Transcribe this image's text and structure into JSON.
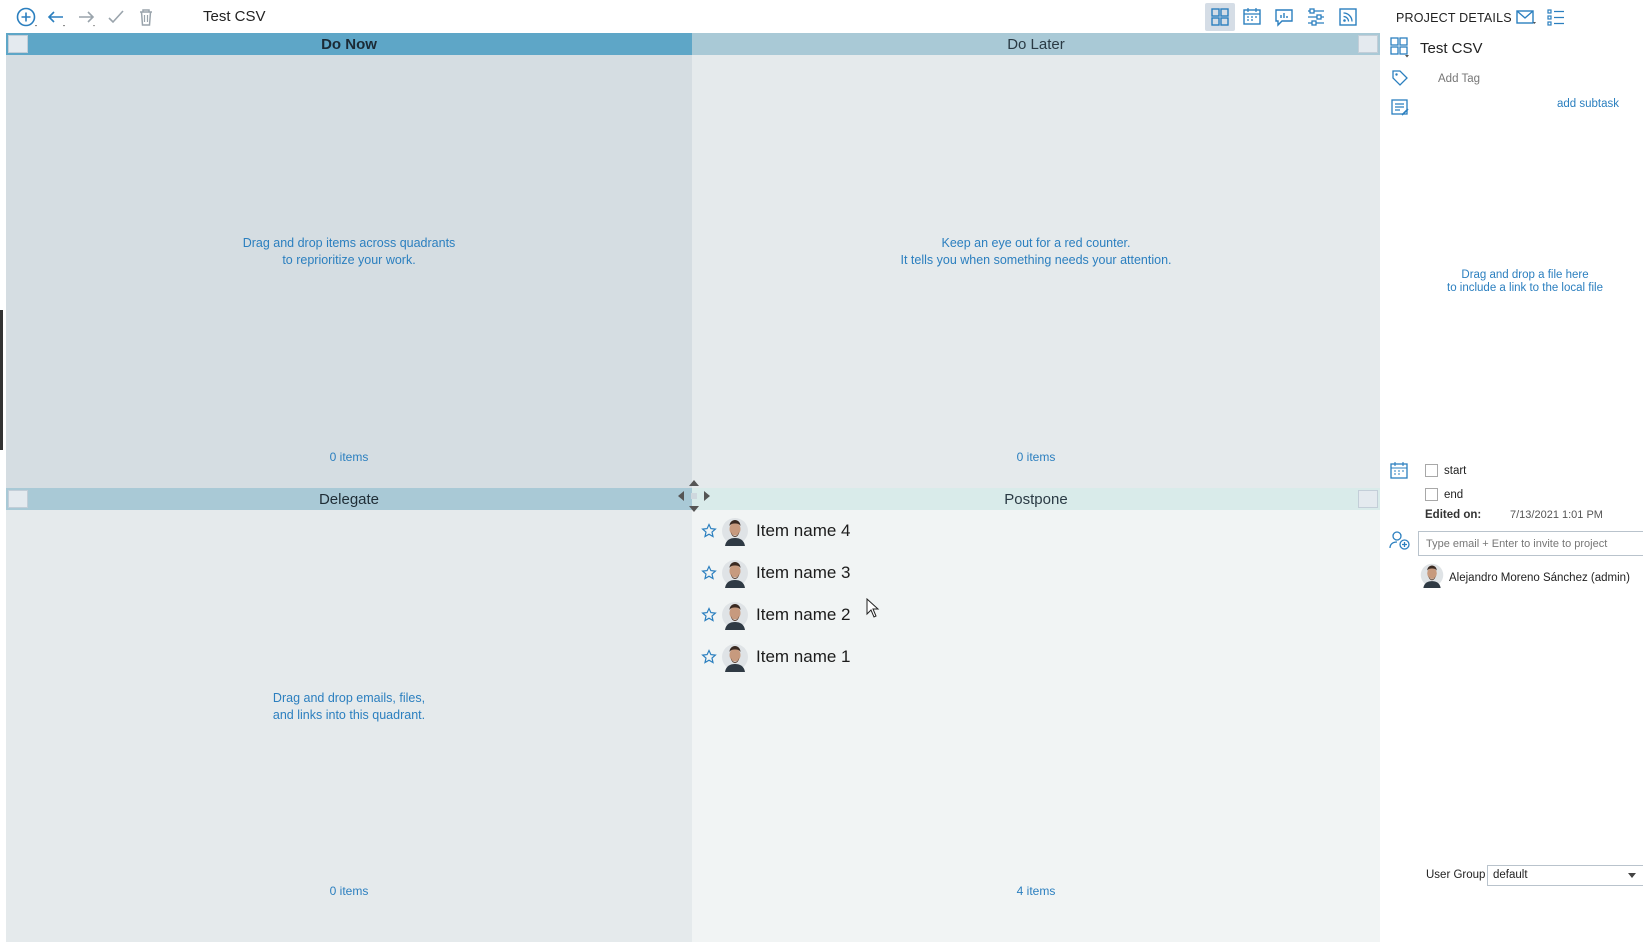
{
  "toolbar": {
    "title": "Test CSV",
    "icons": [
      "add-icon",
      "undo-icon",
      "redo-icon",
      "check-icon",
      "trash-icon"
    ],
    "views": [
      "matrix-view",
      "calendar-view",
      "chat-view",
      "timeline-view",
      "feed-view"
    ]
  },
  "quadrants": {
    "do_now": {
      "title": "Do Now",
      "hint_line1": "Drag and drop items across quadrants",
      "hint_line2": "to reprioritize your work.",
      "count": "0 items"
    },
    "do_later": {
      "title": "Do Later",
      "hint_line1": "Keep an eye out for a red counter.",
      "hint_line2": "It tells you when something needs your attention.",
      "count": "0 items"
    },
    "delegate": {
      "title": "Delegate",
      "hint_line1": "Drag and drop emails, files,",
      "hint_line2": "and links into this quadrant.",
      "count": "0 items"
    },
    "postpone": {
      "title": "Postpone",
      "count": "4 items",
      "items": [
        {
          "name": "Item name 4"
        },
        {
          "name": "Item name 3"
        },
        {
          "name": "Item name 2"
        },
        {
          "name": "Item name 1"
        }
      ]
    }
  },
  "panel": {
    "title": "PROJECT DETAILS",
    "project_name": "Test CSV",
    "add_tag_placeholder": "Add Tag",
    "add_subtask": "add subtask",
    "drop_line1": "Drag and drop a file here",
    "drop_line2": "to include a link to the local file",
    "start_label": "start",
    "end_label": "end",
    "edited_label": "Edited on:",
    "edited_value": "7/13/2021 1:01 PM",
    "invite_placeholder": "Type email + Enter to invite to project",
    "member": "Alejandro Moreno Sánchez (admin)",
    "user_group_label": "User Group",
    "user_group_value": "default"
  },
  "colors": {
    "accent": "#2b7fbf",
    "do_now_header": "#5ea6c7",
    "do_later_header": "#a9c9d6",
    "postpone_header": "#d9ebea"
  }
}
